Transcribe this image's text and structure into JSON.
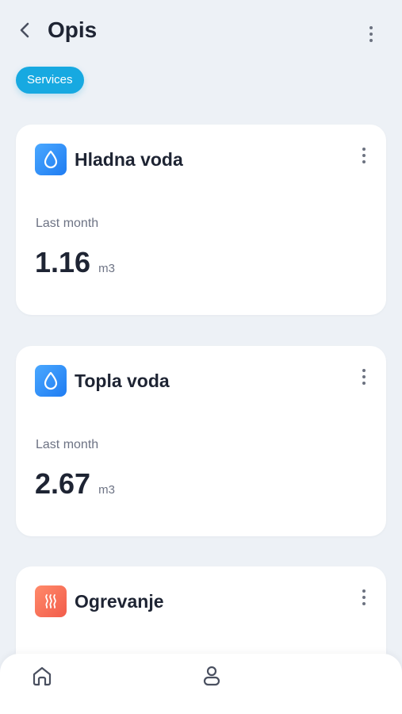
{
  "header": {
    "title": "Opis",
    "back_icon": "chevron-left-icon",
    "menu_icon": "more-vertical-icon"
  },
  "filter_chip": {
    "label": "Services",
    "color": "#17a9e1"
  },
  "cards": [
    {
      "title": "Hladna voda",
      "icon": "water-drop-icon",
      "label": "Last month",
      "value": "1.16",
      "unit": "m3"
    },
    {
      "title": "Topla voda",
      "icon": "water-drop-icon",
      "label": "Last month",
      "value": "2.67",
      "unit": "m3"
    },
    {
      "title": "Ogrevanje",
      "icon": "heat-waves-icon"
    }
  ],
  "bottom_nav": {
    "items": [
      {
        "icon": "home-icon"
      },
      {
        "icon": "profile-icon"
      }
    ]
  },
  "colors": {
    "background": "#edf1f6",
    "water_icon": "#2f8ef7",
    "heat_icon": "#f46a55",
    "text_primary": "#1e2433",
    "text_secondary": "#6d7384"
  }
}
